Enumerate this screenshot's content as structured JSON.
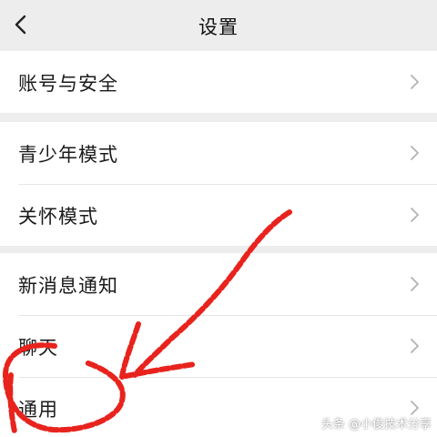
{
  "header": {
    "title": "设置",
    "back_icon": "chevron-left-icon"
  },
  "groups": [
    {
      "items": [
        {
          "label": "账号与安全"
        }
      ]
    },
    {
      "items": [
        {
          "label": "青少年模式"
        },
        {
          "label": "关怀模式"
        }
      ]
    },
    {
      "items": [
        {
          "label": "新消息通知"
        },
        {
          "label": "聊天"
        },
        {
          "label": "通用"
        }
      ]
    }
  ],
  "annotation": {
    "color": "#e8231d"
  },
  "watermark": "头条 @小俊技术分享",
  "colors": {
    "background": "#ededed",
    "row_background": "#ffffff",
    "text": "#1a1a1a",
    "chevron": "#b2b2b2"
  }
}
